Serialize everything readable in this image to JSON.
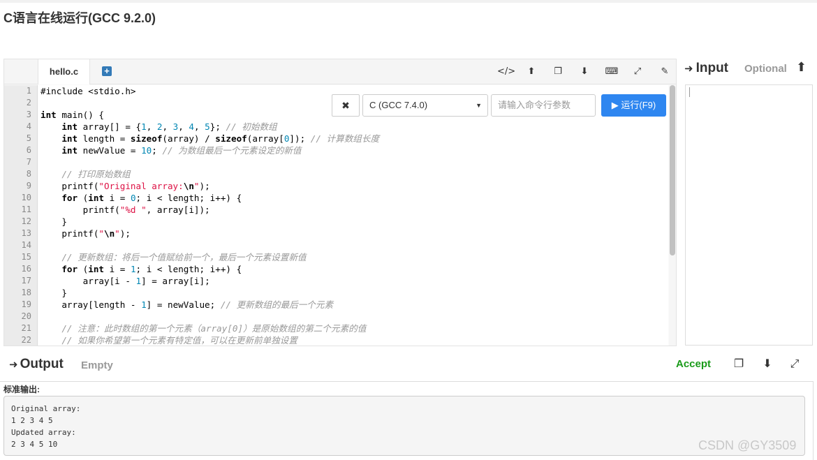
{
  "page": {
    "title": "C语言在线运行(GCC 9.2.0)"
  },
  "editor": {
    "tab_label": "hello.c",
    "add_tab_symbol": "+",
    "toolbar_icons": [
      "code-icon",
      "upload-icon",
      "copy-icon",
      "download-icon",
      "keyboard-icon",
      "fullscreen-icon",
      "edit-icon"
    ],
    "toolbar_glyphs": [
      "</>",
      "⬆",
      "❐",
      "⬇",
      "⌨",
      "⤢",
      "✎"
    ],
    "line_numbers": [
      "1",
      "2",
      "3",
      "4",
      "5",
      "6",
      "7",
      "8",
      "9",
      "10",
      "11",
      "12",
      "13",
      "14",
      "15",
      "16",
      "17",
      "18",
      "19",
      "20",
      "21",
      "22"
    ],
    "code_lines": [
      [
        {
          "t": "#include <stdio.h>",
          "c": ""
        }
      ],
      [],
      [
        {
          "t": "int",
          "c": "kw"
        },
        {
          "t": " main() {",
          "c": ""
        }
      ],
      [
        {
          "t": "    ",
          "c": ""
        },
        {
          "t": "int",
          "c": "kw"
        },
        {
          "t": " array[] = {",
          "c": ""
        },
        {
          "t": "1",
          "c": "num"
        },
        {
          "t": ", ",
          "c": ""
        },
        {
          "t": "2",
          "c": "num"
        },
        {
          "t": ", ",
          "c": ""
        },
        {
          "t": "3",
          "c": "num"
        },
        {
          "t": ", ",
          "c": ""
        },
        {
          "t": "4",
          "c": "num"
        },
        {
          "t": ", ",
          "c": ""
        },
        {
          "t": "5",
          "c": "num"
        },
        {
          "t": "}; ",
          "c": ""
        },
        {
          "t": "// 初始数组",
          "c": "cm"
        }
      ],
      [
        {
          "t": "    ",
          "c": ""
        },
        {
          "t": "int",
          "c": "kw"
        },
        {
          "t": " length = ",
          "c": ""
        },
        {
          "t": "sizeof",
          "c": "kw"
        },
        {
          "t": "(array) / ",
          "c": ""
        },
        {
          "t": "sizeof",
          "c": "kw"
        },
        {
          "t": "(array[",
          "c": ""
        },
        {
          "t": "0",
          "c": "num"
        },
        {
          "t": "]); ",
          "c": ""
        },
        {
          "t": "// 计算数组长度",
          "c": "cm"
        }
      ],
      [
        {
          "t": "    ",
          "c": ""
        },
        {
          "t": "int",
          "c": "kw"
        },
        {
          "t": " newValue = ",
          "c": ""
        },
        {
          "t": "10",
          "c": "num"
        },
        {
          "t": "; ",
          "c": ""
        },
        {
          "t": "// 为数组最后一个元素设定的新值",
          "c": "cm"
        }
      ],
      [],
      [
        {
          "t": "    ",
          "c": ""
        },
        {
          "t": "// 打印原始数组",
          "c": "cm"
        }
      ],
      [
        {
          "t": "    printf(",
          "c": ""
        },
        {
          "t": "\"Original array:",
          "c": "str"
        },
        {
          "t": "\\n",
          "c": "esc"
        },
        {
          "t": "\"",
          "c": "str"
        },
        {
          "t": ");",
          "c": ""
        }
      ],
      [
        {
          "t": "    ",
          "c": ""
        },
        {
          "t": "for",
          "c": "kw"
        },
        {
          "t": " (",
          "c": ""
        },
        {
          "t": "int",
          "c": "kw"
        },
        {
          "t": " i = ",
          "c": ""
        },
        {
          "t": "0",
          "c": "num"
        },
        {
          "t": "; i < length; i++) {",
          "c": ""
        }
      ],
      [
        {
          "t": "        printf(",
          "c": ""
        },
        {
          "t": "\"%d \"",
          "c": "str"
        },
        {
          "t": ", array[i]);",
          "c": ""
        }
      ],
      [
        {
          "t": "    }",
          "c": ""
        }
      ],
      [
        {
          "t": "    printf(",
          "c": ""
        },
        {
          "t": "\"",
          "c": "str"
        },
        {
          "t": "\\n",
          "c": "esc"
        },
        {
          "t": "\"",
          "c": "str"
        },
        {
          "t": ");",
          "c": ""
        }
      ],
      [],
      [
        {
          "t": "    ",
          "c": ""
        },
        {
          "t": "// 更新数组：将后一个值赋给前一个，最后一个元素设置新值",
          "c": "cm"
        }
      ],
      [
        {
          "t": "    ",
          "c": ""
        },
        {
          "t": "for",
          "c": "kw"
        },
        {
          "t": " (",
          "c": ""
        },
        {
          "t": "int",
          "c": "kw"
        },
        {
          "t": " i = ",
          "c": ""
        },
        {
          "t": "1",
          "c": "num"
        },
        {
          "t": "; i < length; i++) {",
          "c": ""
        }
      ],
      [
        {
          "t": "        array[i - ",
          "c": ""
        },
        {
          "t": "1",
          "c": "num"
        },
        {
          "t": "] = array[i];",
          "c": ""
        }
      ],
      [
        {
          "t": "    }",
          "c": ""
        }
      ],
      [
        {
          "t": "    array[length - ",
          "c": ""
        },
        {
          "t": "1",
          "c": "num"
        },
        {
          "t": "] = newValue; ",
          "c": ""
        },
        {
          "t": "// 更新数组的最后一个元素",
          "c": "cm"
        }
      ],
      [],
      [
        {
          "t": "    ",
          "c": ""
        },
        {
          "t": "// 注意：此时数组的第一个元素（array[0]）是原始数组的第二个元素的值",
          "c": "cm"
        }
      ],
      [
        {
          "t": "    ",
          "c": ""
        },
        {
          "t": "// 如果你希望第一个元素有特定值，可以在更新前单独设置",
          "c": "cm"
        }
      ]
    ]
  },
  "run_bar": {
    "clear_label": "✖",
    "language_selected": "C (GCC 7.4.0)",
    "args_placeholder": "请输入命令行参数",
    "run_label": "▶ 运行(F9)"
  },
  "input": {
    "title": "Input",
    "icon_glyph": "➜",
    "optional_label": "Optional",
    "upload_glyph": "⬆"
  },
  "output": {
    "title": "Output",
    "icon_glyph": "➜",
    "status": "Empty",
    "accept_label": "Accept",
    "tool_glyphs": [
      "❐",
      "⬇",
      "⤢"
    ],
    "stdout_label": "标准输出:",
    "stdout_lines": [
      "Original array:",
      "1 2 3 4 5",
      "Updated array:",
      "2 3 4 5 10"
    ]
  },
  "watermark": "CSDN @GY3509",
  "colors": {
    "run_button": "#2e86f0",
    "accept": "#1a9b1a",
    "keyword": "#000000",
    "number": "#0086b3",
    "string": "#dd1144",
    "comment": "#999999"
  }
}
